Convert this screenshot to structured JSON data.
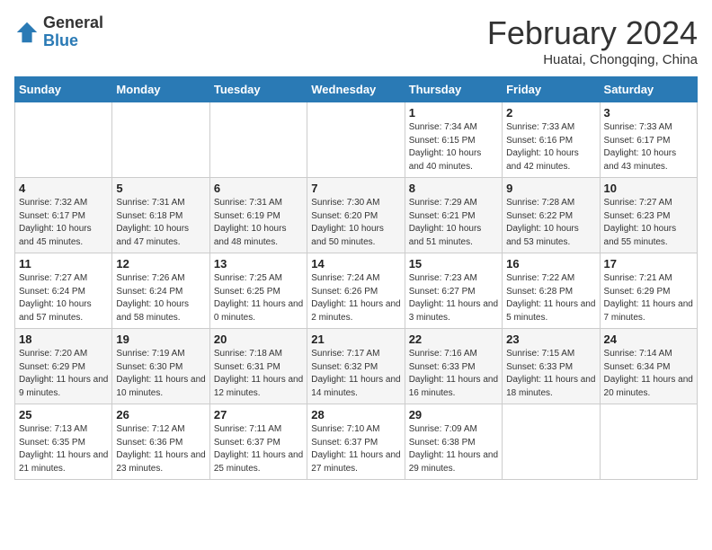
{
  "header": {
    "logo_general": "General",
    "logo_blue": "Blue",
    "month_title": "February 2024",
    "location": "Huatai, Chongqing, China"
  },
  "weekdays": [
    "Sunday",
    "Monday",
    "Tuesday",
    "Wednesday",
    "Thursday",
    "Friday",
    "Saturday"
  ],
  "weeks": [
    [
      {
        "day": "",
        "info": ""
      },
      {
        "day": "",
        "info": ""
      },
      {
        "day": "",
        "info": ""
      },
      {
        "day": "",
        "info": ""
      },
      {
        "day": "1",
        "info": "Sunrise: 7:34 AM\nSunset: 6:15 PM\nDaylight: 10 hours\nand 40 minutes."
      },
      {
        "day": "2",
        "info": "Sunrise: 7:33 AM\nSunset: 6:16 PM\nDaylight: 10 hours\nand 42 minutes."
      },
      {
        "day": "3",
        "info": "Sunrise: 7:33 AM\nSunset: 6:17 PM\nDaylight: 10 hours\nand 43 minutes."
      }
    ],
    [
      {
        "day": "4",
        "info": "Sunrise: 7:32 AM\nSunset: 6:17 PM\nDaylight: 10 hours\nand 45 minutes."
      },
      {
        "day": "5",
        "info": "Sunrise: 7:31 AM\nSunset: 6:18 PM\nDaylight: 10 hours\nand 47 minutes."
      },
      {
        "day": "6",
        "info": "Sunrise: 7:31 AM\nSunset: 6:19 PM\nDaylight: 10 hours\nand 48 minutes."
      },
      {
        "day": "7",
        "info": "Sunrise: 7:30 AM\nSunset: 6:20 PM\nDaylight: 10 hours\nand 50 minutes."
      },
      {
        "day": "8",
        "info": "Sunrise: 7:29 AM\nSunset: 6:21 PM\nDaylight: 10 hours\nand 51 minutes."
      },
      {
        "day": "9",
        "info": "Sunrise: 7:28 AM\nSunset: 6:22 PM\nDaylight: 10 hours\nand 53 minutes."
      },
      {
        "day": "10",
        "info": "Sunrise: 7:27 AM\nSunset: 6:23 PM\nDaylight: 10 hours\nand 55 minutes."
      }
    ],
    [
      {
        "day": "11",
        "info": "Sunrise: 7:27 AM\nSunset: 6:24 PM\nDaylight: 10 hours\nand 57 minutes."
      },
      {
        "day": "12",
        "info": "Sunrise: 7:26 AM\nSunset: 6:24 PM\nDaylight: 10 hours\nand 58 minutes."
      },
      {
        "day": "13",
        "info": "Sunrise: 7:25 AM\nSunset: 6:25 PM\nDaylight: 11 hours\nand 0 minutes."
      },
      {
        "day": "14",
        "info": "Sunrise: 7:24 AM\nSunset: 6:26 PM\nDaylight: 11 hours\nand 2 minutes."
      },
      {
        "day": "15",
        "info": "Sunrise: 7:23 AM\nSunset: 6:27 PM\nDaylight: 11 hours\nand 3 minutes."
      },
      {
        "day": "16",
        "info": "Sunrise: 7:22 AM\nSunset: 6:28 PM\nDaylight: 11 hours\nand 5 minutes."
      },
      {
        "day": "17",
        "info": "Sunrise: 7:21 AM\nSunset: 6:29 PM\nDaylight: 11 hours\nand 7 minutes."
      }
    ],
    [
      {
        "day": "18",
        "info": "Sunrise: 7:20 AM\nSunset: 6:29 PM\nDaylight: 11 hours\nand 9 minutes."
      },
      {
        "day": "19",
        "info": "Sunrise: 7:19 AM\nSunset: 6:30 PM\nDaylight: 11 hours\nand 10 minutes."
      },
      {
        "day": "20",
        "info": "Sunrise: 7:18 AM\nSunset: 6:31 PM\nDaylight: 11 hours\nand 12 minutes."
      },
      {
        "day": "21",
        "info": "Sunrise: 7:17 AM\nSunset: 6:32 PM\nDaylight: 11 hours\nand 14 minutes."
      },
      {
        "day": "22",
        "info": "Sunrise: 7:16 AM\nSunset: 6:33 PM\nDaylight: 11 hours\nand 16 minutes."
      },
      {
        "day": "23",
        "info": "Sunrise: 7:15 AM\nSunset: 6:33 PM\nDaylight: 11 hours\nand 18 minutes."
      },
      {
        "day": "24",
        "info": "Sunrise: 7:14 AM\nSunset: 6:34 PM\nDaylight: 11 hours\nand 20 minutes."
      }
    ],
    [
      {
        "day": "25",
        "info": "Sunrise: 7:13 AM\nSunset: 6:35 PM\nDaylight: 11 hours\nand 21 minutes."
      },
      {
        "day": "26",
        "info": "Sunrise: 7:12 AM\nSunset: 6:36 PM\nDaylight: 11 hours\nand 23 minutes."
      },
      {
        "day": "27",
        "info": "Sunrise: 7:11 AM\nSunset: 6:37 PM\nDaylight: 11 hours\nand 25 minutes."
      },
      {
        "day": "28",
        "info": "Sunrise: 7:10 AM\nSunset: 6:37 PM\nDaylight: 11 hours\nand 27 minutes."
      },
      {
        "day": "29",
        "info": "Sunrise: 7:09 AM\nSunset: 6:38 PM\nDaylight: 11 hours\nand 29 minutes."
      },
      {
        "day": "",
        "info": ""
      },
      {
        "day": "",
        "info": ""
      }
    ]
  ]
}
